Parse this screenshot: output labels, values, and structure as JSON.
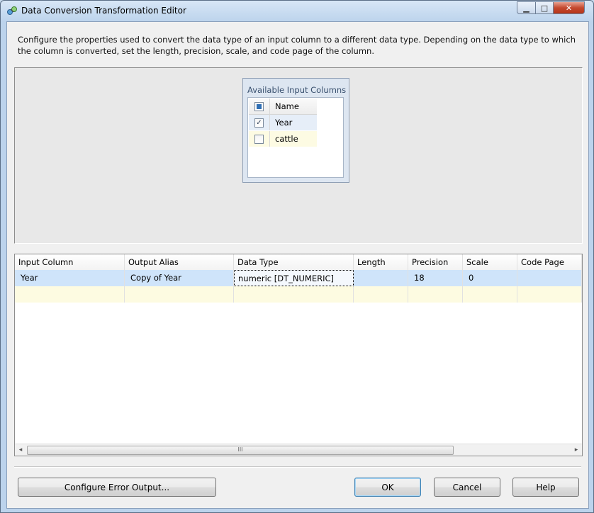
{
  "window": {
    "title": "Data Conversion Transformation Editor",
    "controls": {
      "minimize": "▁",
      "maximize": "□",
      "close": "✕"
    }
  },
  "description": "Configure the properties used to convert the data type of an input column to a different data type. Depending on the data type to which the column is converted, set the length, precision, scale, and code page of the column.",
  "available_columns": {
    "title": "Available Input Columns",
    "header": "Name",
    "rows": [
      {
        "name": "Year",
        "checked": true,
        "check_glyph": "✓"
      },
      {
        "name": "cattle",
        "checked": false,
        "check_glyph": ""
      }
    ]
  },
  "grid": {
    "headers": [
      "Input Column",
      "Output Alias",
      "Data Type",
      "Length",
      "Precision",
      "Scale",
      "Code Page"
    ],
    "rows": [
      {
        "input_column": "Year",
        "output_alias": "Copy of Year",
        "data_type": "numeric [DT_NUMERIC]",
        "length": "",
        "precision": "18",
        "scale": "0",
        "code_page": ""
      }
    ],
    "scroll": {
      "left": "◂",
      "right": "▸",
      "grip": "III"
    }
  },
  "buttons": {
    "configure_error_output": "Configure Error Output...",
    "ok": "OK",
    "cancel": "Cancel",
    "help": "Help"
  },
  "colors": {
    "selection": "#cfe4fa",
    "new_row": "#fdfbe1",
    "accent": "#2f6fb4"
  }
}
